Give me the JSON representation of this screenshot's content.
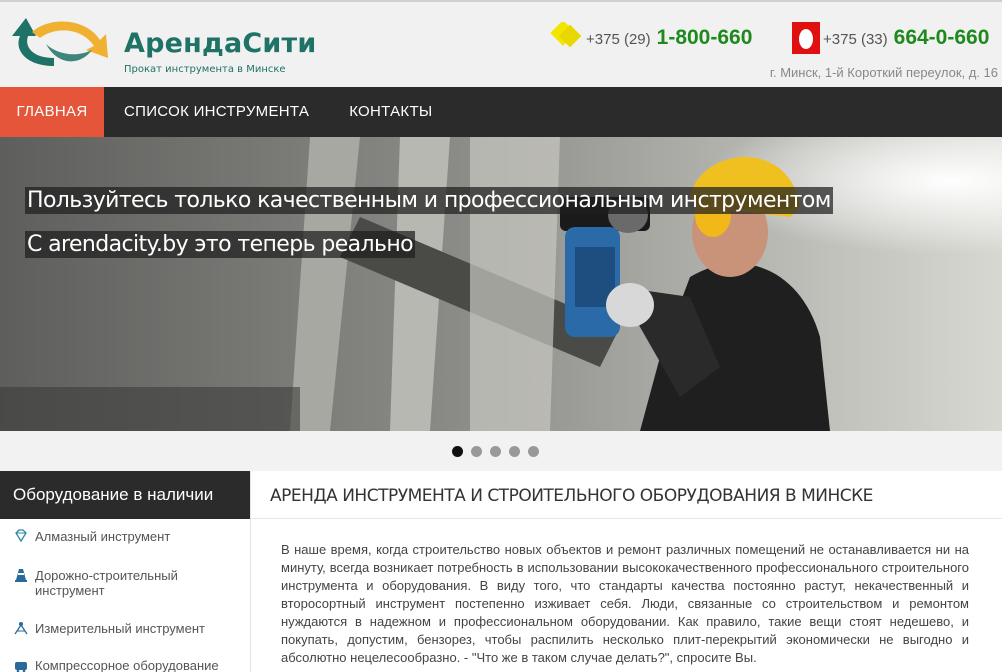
{
  "header": {
    "logo_title": "АрендаСити",
    "logo_subtitle": "Прокат инструмента в Минске",
    "phones": [
      {
        "code": "+375 (29)",
        "number": "1-800-660",
        "operator_icon": "velcom-icon"
      },
      {
        "code": "+375 (33)",
        "number": "664-0-660",
        "operator_icon": "mts-icon"
      }
    ],
    "address": "г. Минск, 1-й Короткий переулок, д. 16",
    "colors": {
      "brand": "#1e7266",
      "phone": "#1e8a1e",
      "accent": "#e4553a"
    }
  },
  "nav": {
    "items": [
      {
        "label": "ГЛАВНАЯ",
        "active": true
      },
      {
        "label": "СПИСОК ИНСТРУМЕНТА",
        "active": false
      },
      {
        "label": "КОНТАКТЫ",
        "active": false
      }
    ]
  },
  "hero": {
    "caption_line1": "Пользуйтесь только качественным и профессиональным инструментом",
    "caption_line2": "С arendacity.by это теперь реально",
    "slide_count": 5,
    "active_slide": 1
  },
  "sidebar": {
    "title": "Оборудование в наличии",
    "items": [
      {
        "label": "Алмазный инструмент",
        "icon": "diamond-icon"
      },
      {
        "label": "Дорожно-строительный инструмент",
        "icon": "traffic-cone-icon"
      },
      {
        "label": "Измерительный инструмент",
        "icon": "tripod-icon"
      },
      {
        "label": "Компрессорное оборудование",
        "icon": "compressor-icon"
      }
    ]
  },
  "main": {
    "title": "АРЕНДА ИНСТРУМЕНТА И СТРОИТЕЛЬНОГО ОБОРУДОВАНИЯ В МИНСКЕ",
    "text": "В наше время, когда строительство новых объектов и ремонт различных помещений не останавливается ни на минуту, всегда возникает потребность в использовании высококачественного профессионального строительного инструмента и оборудования. В виду того, что стандарты качества постоянно растут, некачественный и второсортный инструмент постепенно изживает себя. Люди, связанные со строительством и ремонтом нуждаются в надежном и профессиональном оборудовании. Как правило, такие вещи стоят недешево, и покупать, допустим, бензорез, чтобы распилить несколько плит-перекрытий экономически не выгодно и абсолютно нецелесообразно. - \"Что же в таком случае делать?\", спросите Вы."
  }
}
